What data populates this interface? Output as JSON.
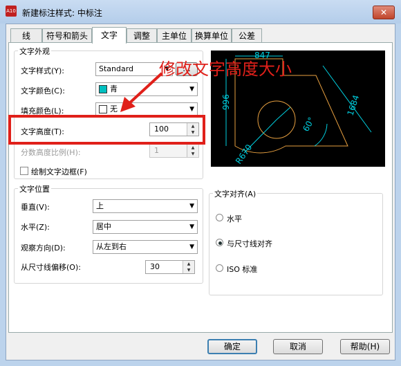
{
  "window": {
    "title": "新建标注样式: 中标注",
    "close_label": "✕",
    "app_icon_label": "A10"
  },
  "tabs": [
    {
      "label": "线",
      "active": false
    },
    {
      "label": "符号和箭头",
      "active": false
    },
    {
      "label": "文字",
      "active": true
    },
    {
      "label": "调整",
      "active": false
    },
    {
      "label": "主单位",
      "active": false
    },
    {
      "label": "换算单位",
      "active": false
    },
    {
      "label": "公差",
      "active": false
    }
  ],
  "text_appearance": {
    "title": "文字外观",
    "style_label": "文字样式(Y):",
    "style_value": "Standard",
    "style_ellipsis": "...",
    "color_label": "文字颜色(C):",
    "color_value": "青",
    "color_swatch": "#00c0c0",
    "fill_label": "填充颜色(L):",
    "fill_value": "无",
    "height_label": "文字高度(T):",
    "height_value": "100",
    "fraction_label": "分数高度比例(H):",
    "fraction_value": "1",
    "frame_label": "绘制文字边框(F)",
    "frame_checked": false
  },
  "text_placement": {
    "title": "文字位置",
    "vertical_label": "垂直(V):",
    "vertical_value": "上",
    "horizontal_label": "水平(Z):",
    "horizontal_value": "居中",
    "view_label": "观察方向(D):",
    "view_value": "从左到右",
    "offset_label": "从尺寸线偏移(O):",
    "offset_value": "30"
  },
  "text_alignment": {
    "title": "文字对齐(A)",
    "options": [
      {
        "label": "水平",
        "selected": false
      },
      {
        "label": "与尺寸线对齐",
        "selected": true
      },
      {
        "label": "ISO 标准",
        "selected": false
      }
    ]
  },
  "preview": {
    "dims": [
      "847",
      "996",
      "1684",
      "60°",
      "R670"
    ],
    "line_color": "#e8a040",
    "dim_color": "#00d0e0"
  },
  "annotation": {
    "text": "修改文字高度大小",
    "color": "#e0201a"
  },
  "buttons": {
    "ok": "确定",
    "cancel": "取消",
    "help": "帮助(H)"
  }
}
